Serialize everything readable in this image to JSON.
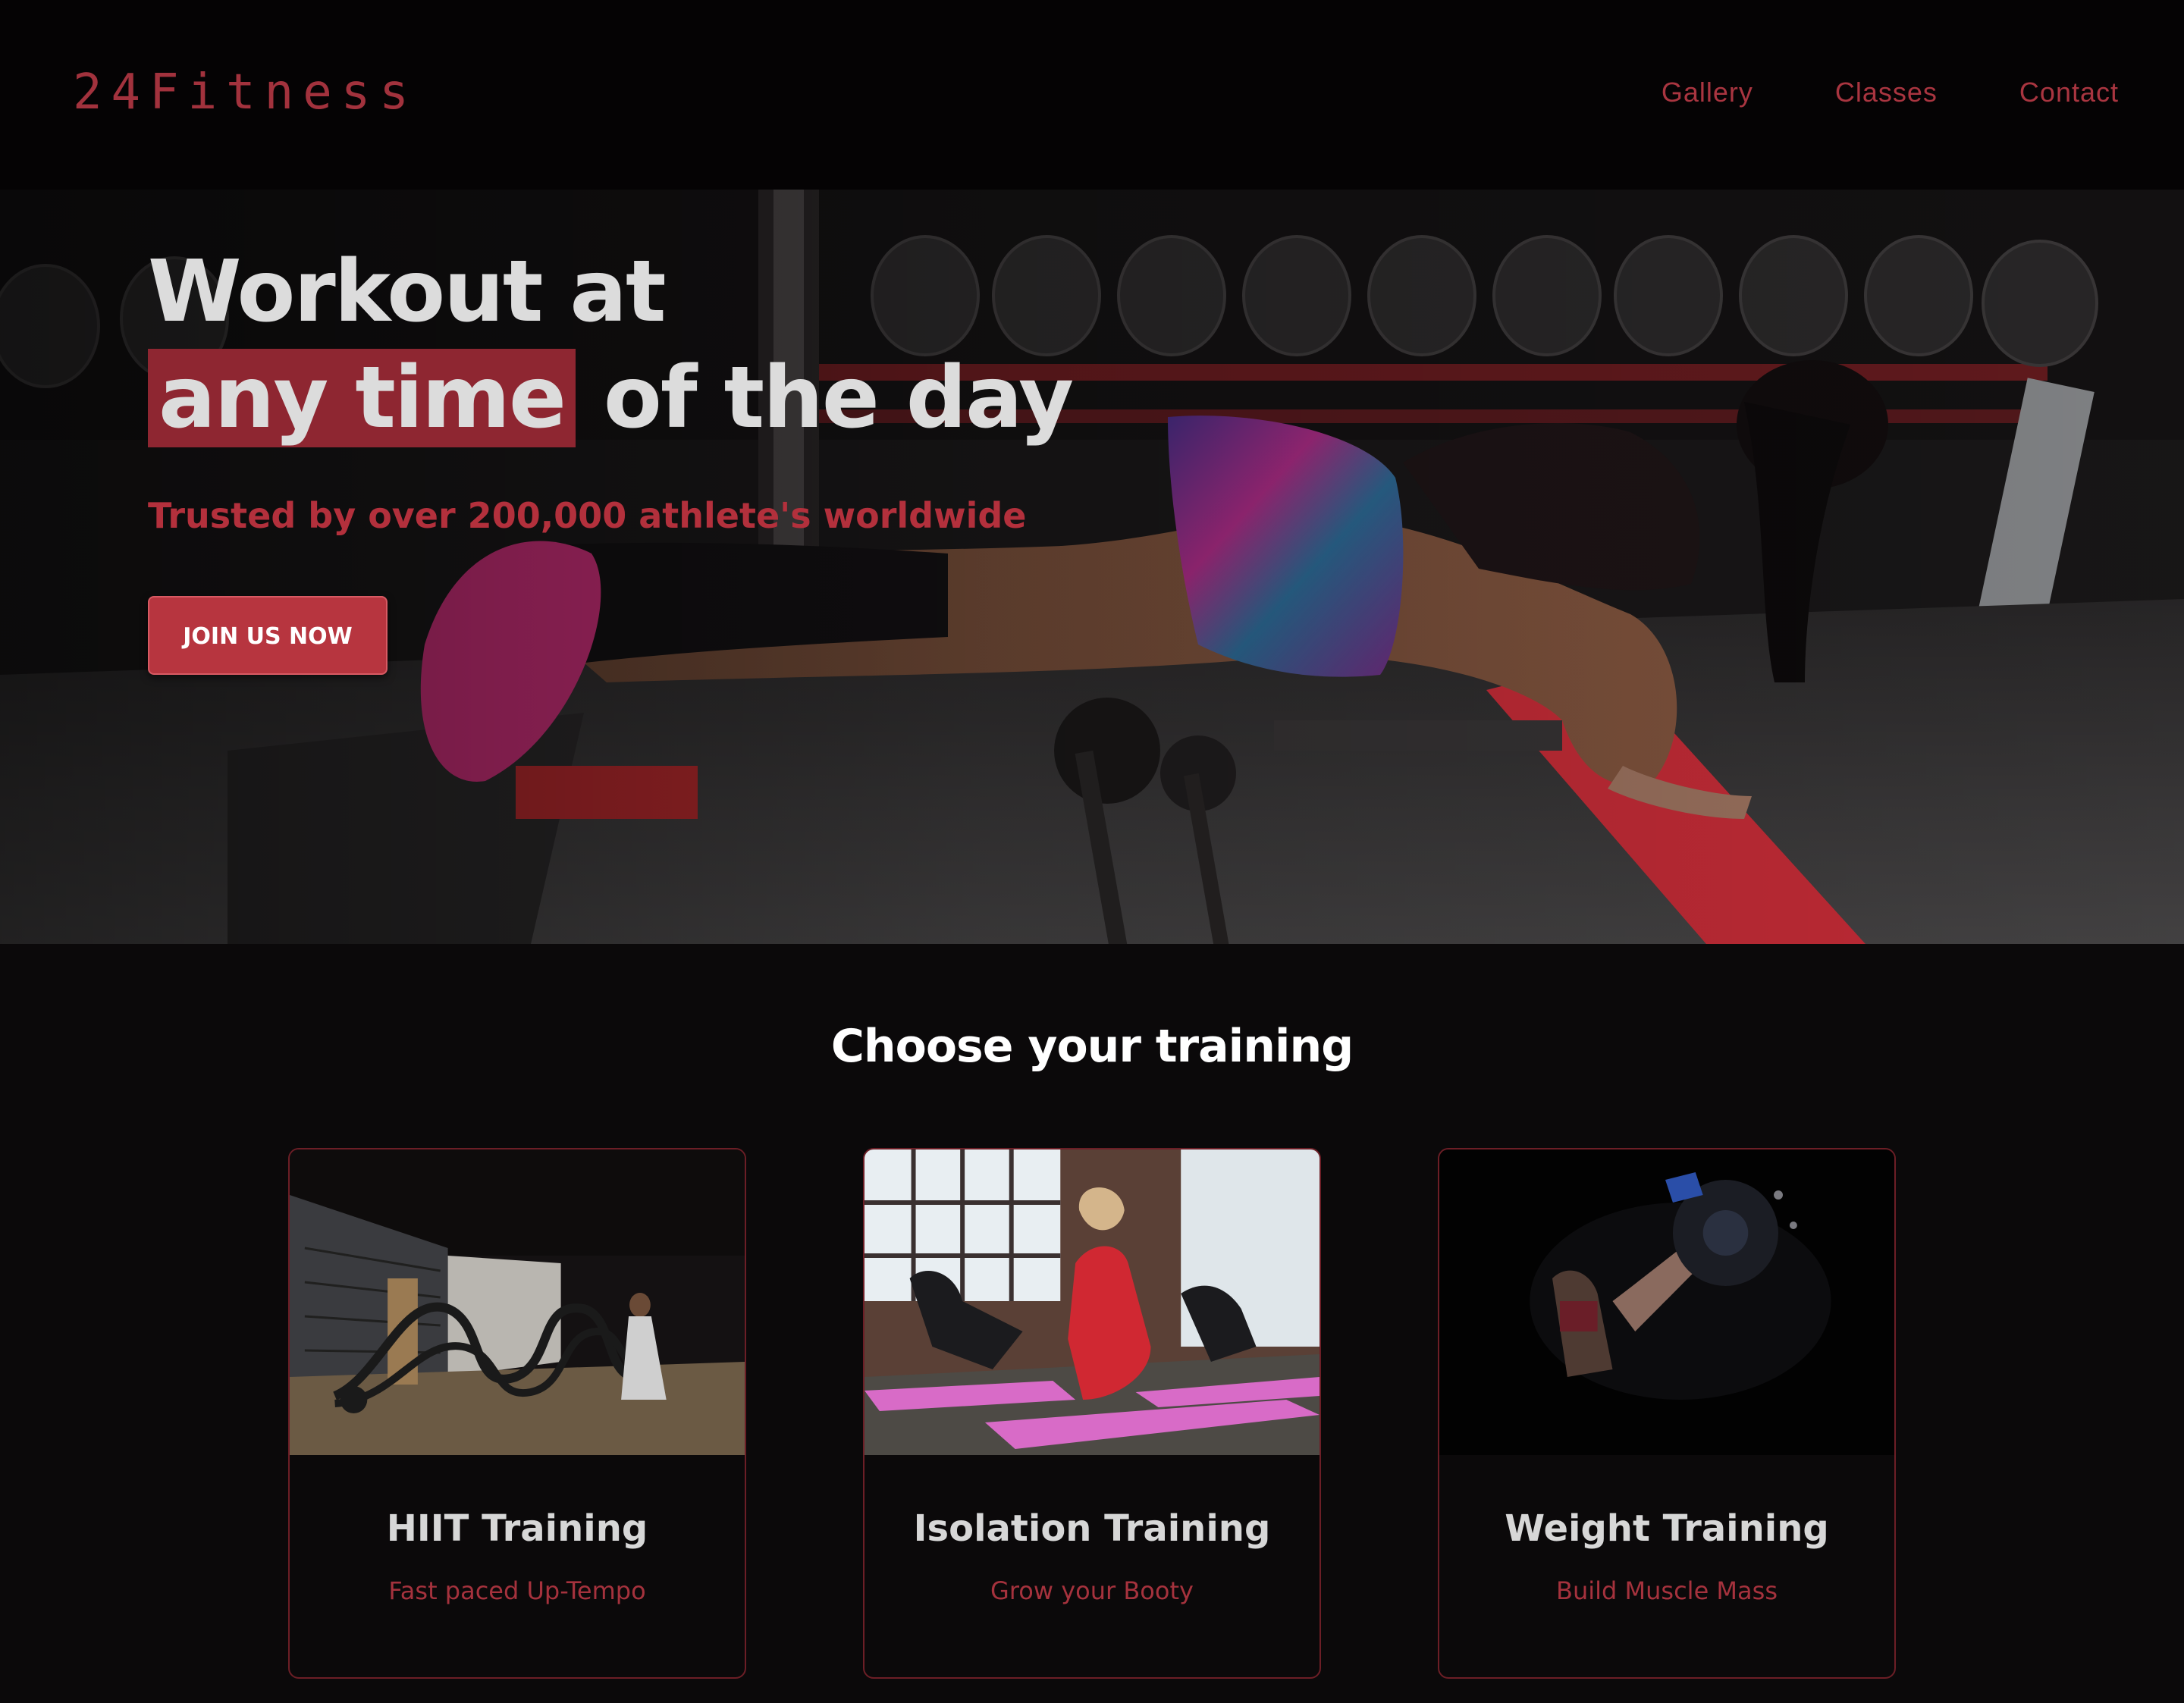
{
  "brand": {
    "logo": "24Fitness",
    "accent": "#a2323d"
  },
  "nav": {
    "items": [
      {
        "label": "Gallery"
      },
      {
        "label": "Classes"
      },
      {
        "label": "Contact"
      }
    ]
  },
  "hero": {
    "title_line1": "Workout at",
    "title_highlight": "any time",
    "title_rest": "of the day",
    "subtitle": "Trusted by over 200,000 athlete's worldwide",
    "cta_label": "JOIN US NOW",
    "image": "woman-doing-decline-pushup-in-gym"
  },
  "training": {
    "title": "Choose your training",
    "cards": [
      {
        "title": "HIIT Training",
        "subtitle": "Fast paced Up-Tempo",
        "image": "battle-ropes"
      },
      {
        "title": "Isolation Training",
        "subtitle": "Grow your Booty",
        "image": "group-glute-class"
      },
      {
        "title": "Weight Training",
        "subtitle": "Build Muscle Mass",
        "image": "leg-press"
      }
    ]
  }
}
